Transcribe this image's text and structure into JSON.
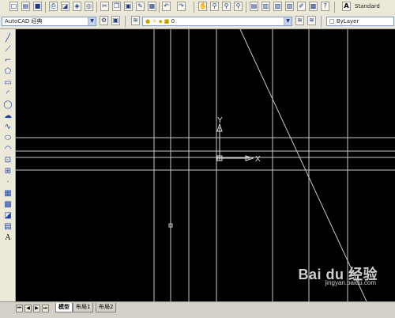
{
  "toolbar": {
    "text_style": "Standard",
    "workspace": "AutoCAD 经典",
    "layer": "0",
    "color": "ByLayer"
  },
  "icons": {
    "top_row": [
      "new-icon",
      "open-icon",
      "save-icon",
      "print-icon",
      "preview-icon",
      "publish-icon",
      "plot-icon",
      "cut-icon",
      "copy-icon",
      "paste-icon",
      "match-prop-icon",
      "undo-icon",
      "redo-icon",
      "pan-icon",
      "zoom-realtime-icon",
      "zoom-window-icon",
      "zoom-previous-icon",
      "properties-icon",
      "design-center-icon",
      "tool-palette-icon",
      "sheet-set-icon",
      "markup-icon",
      "calculator-icon",
      "help-icon"
    ],
    "left_column": [
      "line-icon",
      "construction-line-icon",
      "polyline-icon",
      "polygon-icon",
      "rectangle-icon",
      "arc-icon",
      "circle-icon",
      "revcloud-icon",
      "spline-icon",
      "ellipse-icon",
      "ellipse-arc-icon",
      "insert-block-icon",
      "make-block-icon",
      "point-icon",
      "hatch-icon",
      "gradient-icon",
      "region-icon",
      "table-icon",
      "multiline-text-icon"
    ]
  },
  "canvas": {
    "ucs": {
      "y_label": "Y",
      "x_label": "X"
    },
    "background": "#000000",
    "line_color": "#c8c8c8"
  },
  "layout_tabs": [
    "模型",
    "布局1",
    "布局2"
  ],
  "watermark": {
    "brand": "Bai du 经验",
    "url": "jingyan.baidu.com"
  }
}
